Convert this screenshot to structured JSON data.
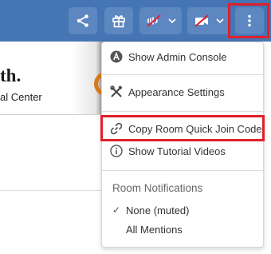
{
  "toolbar": {
    "buttons": [
      {
        "name": "share-button",
        "icon": "share-icon"
      },
      {
        "name": "gift-button",
        "icon": "gift-icon"
      },
      {
        "name": "audio-muted-button",
        "icon": "audio-muted-icon"
      },
      {
        "name": "video-off-button",
        "icon": "video-off-icon"
      },
      {
        "name": "more-options-button",
        "icon": "vertical-ellipsis-icon"
      }
    ],
    "colors": {
      "bar": "#4575b4",
      "button": "#5d87c0",
      "highlight": "#e0202a"
    }
  },
  "banner": {
    "title": "th.",
    "subtitle": "al Center"
  },
  "menu": {
    "items": [
      {
        "label": "Show Admin Console",
        "icon": "admin-a-icon"
      },
      {
        "label": "Appearance Settings",
        "icon": "tools-icon"
      },
      {
        "label": "Copy Room Quick Join Code",
        "icon": "link-icon"
      },
      {
        "label": "Show Tutorial Videos",
        "icon": "info-icon"
      }
    ],
    "notifications": {
      "heading": "Room Notifications",
      "options": [
        {
          "label": "None (muted)",
          "selected": true,
          "check": "✓"
        },
        {
          "label": "All Mentions",
          "selected": false
        }
      ]
    }
  }
}
